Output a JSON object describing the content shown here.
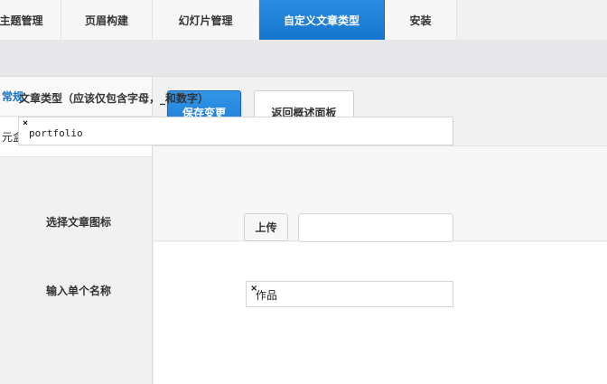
{
  "tabs": [
    {
      "label": "主题管理"
    },
    {
      "label": "页眉构建"
    },
    {
      "label": "幻灯片管理"
    },
    {
      "label": "自定义文章类型"
    },
    {
      "label": "安装"
    }
  ],
  "sidebar": {
    "items": [
      {
        "label": "常规"
      },
      {
        "label": "元盒"
      }
    ]
  },
  "toolbar": {
    "save_label": "保存变更",
    "back_label": "返回概述面板"
  },
  "form": {
    "post_type_label": "文章类型（应该仅包含字母，_和数字）",
    "post_type_value": "portfolio",
    "remove_glyph": "×",
    "icon_label": "选择文章图标",
    "upload_label": "上传",
    "icon_value": "",
    "singular_label": "输入单个名称",
    "singular_value": "作品"
  },
  "colors": {
    "accent": "#1a7ad2",
    "active_sidebar_text": "#1a6fc4"
  }
}
